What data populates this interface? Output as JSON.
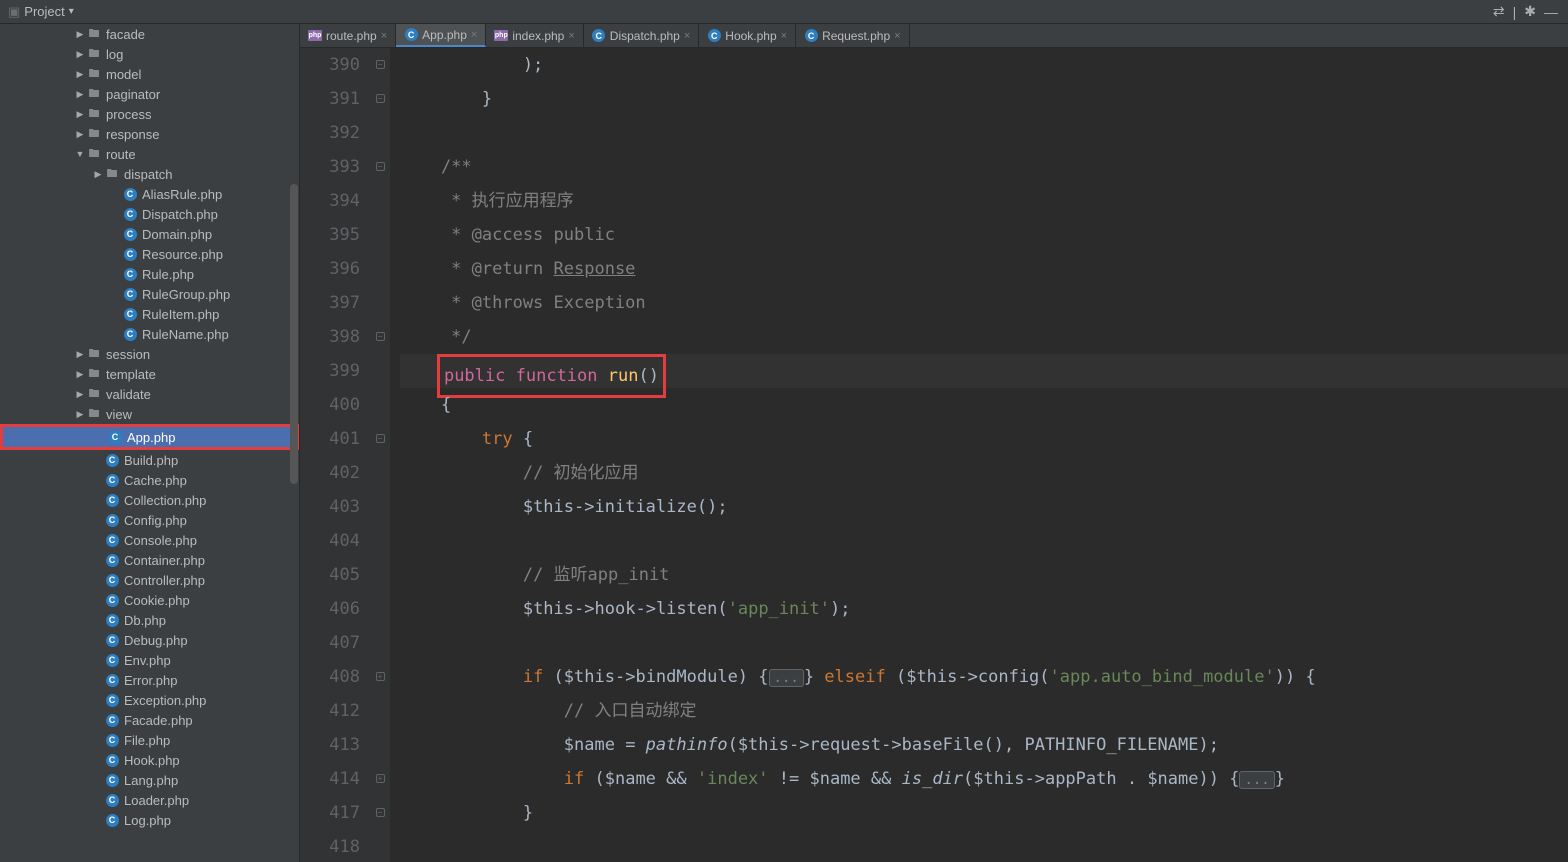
{
  "toolbar": {
    "project_label": "Project"
  },
  "tree": [
    {
      "depth": 3,
      "arrow": "▶",
      "type": "folder",
      "label": "facade"
    },
    {
      "depth": 3,
      "arrow": "▶",
      "type": "folder",
      "label": "log"
    },
    {
      "depth": 3,
      "arrow": "▶",
      "type": "folder",
      "label": "model"
    },
    {
      "depth": 3,
      "arrow": "▶",
      "type": "folder",
      "label": "paginator"
    },
    {
      "depth": 3,
      "arrow": "▶",
      "type": "folder",
      "label": "process"
    },
    {
      "depth": 3,
      "arrow": "▶",
      "type": "folder",
      "label": "response"
    },
    {
      "depth": 3,
      "arrow": "▼",
      "type": "folder",
      "label": "route"
    },
    {
      "depth": 4,
      "arrow": "▶",
      "type": "folder",
      "label": "dispatch"
    },
    {
      "depth": 5,
      "arrow": "",
      "type": "class",
      "label": "AliasRule.php"
    },
    {
      "depth": 5,
      "arrow": "",
      "type": "class",
      "label": "Dispatch.php"
    },
    {
      "depth": 5,
      "arrow": "",
      "type": "class",
      "label": "Domain.php"
    },
    {
      "depth": 5,
      "arrow": "",
      "type": "class",
      "label": "Resource.php"
    },
    {
      "depth": 5,
      "arrow": "",
      "type": "class",
      "label": "Rule.php"
    },
    {
      "depth": 5,
      "arrow": "",
      "type": "class",
      "label": "RuleGroup.php"
    },
    {
      "depth": 5,
      "arrow": "",
      "type": "class",
      "label": "RuleItem.php"
    },
    {
      "depth": 5,
      "arrow": "",
      "type": "class",
      "label": "RuleName.php"
    },
    {
      "depth": 3,
      "arrow": "▶",
      "type": "folder",
      "label": "session"
    },
    {
      "depth": 3,
      "arrow": "▶",
      "type": "folder",
      "label": "template"
    },
    {
      "depth": 3,
      "arrow": "▶",
      "type": "folder",
      "label": "validate"
    },
    {
      "depth": 3,
      "arrow": "▶",
      "type": "folder",
      "label": "view"
    },
    {
      "depth": 4,
      "arrow": "",
      "type": "class",
      "label": "App.php",
      "selected": true,
      "highlighted": true
    },
    {
      "depth": 4,
      "arrow": "",
      "type": "class",
      "label": "Build.php"
    },
    {
      "depth": 4,
      "arrow": "",
      "type": "class",
      "label": "Cache.php"
    },
    {
      "depth": 4,
      "arrow": "",
      "type": "class",
      "label": "Collection.php"
    },
    {
      "depth": 4,
      "arrow": "",
      "type": "class",
      "label": "Config.php"
    },
    {
      "depth": 4,
      "arrow": "",
      "type": "class",
      "label": "Console.php"
    },
    {
      "depth": 4,
      "arrow": "",
      "type": "class",
      "label": "Container.php"
    },
    {
      "depth": 4,
      "arrow": "",
      "type": "class",
      "label": "Controller.php"
    },
    {
      "depth": 4,
      "arrow": "",
      "type": "class",
      "label": "Cookie.php"
    },
    {
      "depth": 4,
      "arrow": "",
      "type": "class",
      "label": "Db.php"
    },
    {
      "depth": 4,
      "arrow": "",
      "type": "class",
      "label": "Debug.php"
    },
    {
      "depth": 4,
      "arrow": "",
      "type": "class",
      "label": "Env.php"
    },
    {
      "depth": 4,
      "arrow": "",
      "type": "class",
      "label": "Error.php"
    },
    {
      "depth": 4,
      "arrow": "",
      "type": "class",
      "label": "Exception.php"
    },
    {
      "depth": 4,
      "arrow": "",
      "type": "class",
      "label": "Facade.php"
    },
    {
      "depth": 4,
      "arrow": "",
      "type": "class",
      "label": "File.php"
    },
    {
      "depth": 4,
      "arrow": "",
      "type": "class",
      "label": "Hook.php"
    },
    {
      "depth": 4,
      "arrow": "",
      "type": "class",
      "label": "Lang.php"
    },
    {
      "depth": 4,
      "arrow": "",
      "type": "class",
      "label": "Loader.php"
    },
    {
      "depth": 4,
      "arrow": "",
      "type": "class",
      "label": "Log.php"
    }
  ],
  "tabs": [
    {
      "icon": "php",
      "label": "route.php",
      "active": false
    },
    {
      "icon": "class",
      "label": "App.php",
      "active": true
    },
    {
      "icon": "php",
      "label": "index.php",
      "active": false
    },
    {
      "icon": "class",
      "label": "Dispatch.php",
      "active": false
    },
    {
      "icon": "class",
      "label": "Hook.php",
      "active": false
    },
    {
      "icon": "class",
      "label": "Request.php",
      "active": false
    }
  ],
  "code": {
    "line_numbers": [
      "390",
      "391",
      "392",
      "393",
      "394",
      "395",
      "396",
      "397",
      "398",
      "399",
      "400",
      "401",
      "402",
      "403",
      "404",
      "405",
      "406",
      "407",
      "408",
      "412",
      "413",
      "414",
      "417",
      "418"
    ],
    "fold_marks": {
      "0": "⊟",
      "1": "⊟",
      "3": "⊟",
      "8": "⊟",
      "9": "",
      "11": "⊟",
      "18": "⊞",
      "21": "⊞",
      "22": "⊟"
    },
    "lines": [
      "            );",
      "        }",
      "",
      "    /**",
      "     * 执行应用程序",
      "     * @access public",
      "     * @return Response",
      "     * @throws Exception",
      "     */",
      "    public function run()",
      "    {",
      "        try {",
      "            // 初始化应用",
      "            $this->initialize();",
      "",
      "            // 监听app_init",
      "            $this->hook->listen('app_init');",
      "",
      "            if ($this->bindModule) {...} elseif ($this->config('app.auto_bind_module')) {",
      "                // 入口自动绑定",
      "                $name = pathinfo($this->request->baseFile(), PATHINFO_FILENAME);",
      "                if ($name && 'index' != $name && is_dir($this->appPath . $name)) {...}",
      "            }",
      ""
    ]
  }
}
